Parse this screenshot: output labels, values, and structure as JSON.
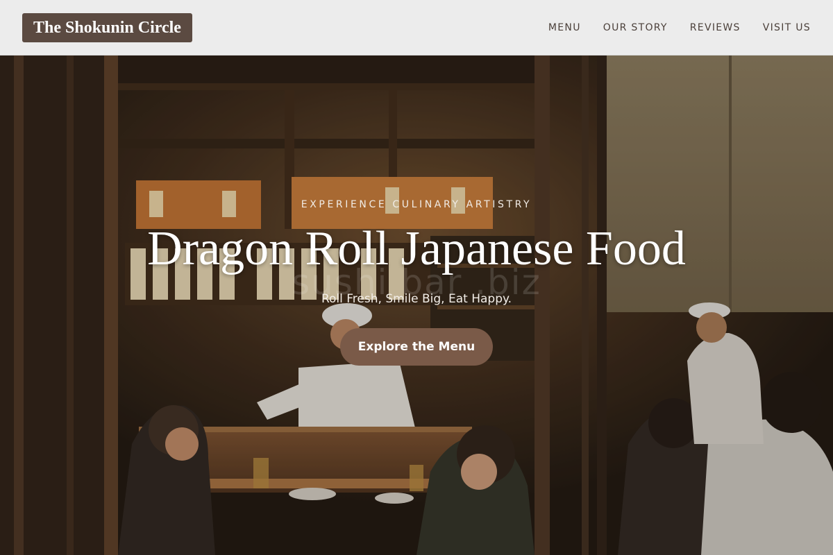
{
  "header": {
    "logo_text": "The Shokunin Circle",
    "nav": [
      {
        "label": "MENU"
      },
      {
        "label": "OUR STORY"
      },
      {
        "label": "REVIEWS"
      },
      {
        "label": "VISIT US"
      }
    ]
  },
  "hero": {
    "eyebrow": "EXPERIENCE CULINARY ARTISTRY",
    "title": "Dragon Roll Japanese Food",
    "watermark": "sushi bar .biz",
    "tagline": "Roll Fresh, Smile Big, Eat Happy.",
    "cta_label": "Explore the Menu",
    "background_image": "restaurant-interior-photo"
  },
  "colors": {
    "header_bg": "#ececec",
    "logo_bg": "#5b4a41",
    "nav_text": "#4a3f39",
    "cta_bg": "#7a5a48",
    "hero_text": "#ffffff"
  }
}
